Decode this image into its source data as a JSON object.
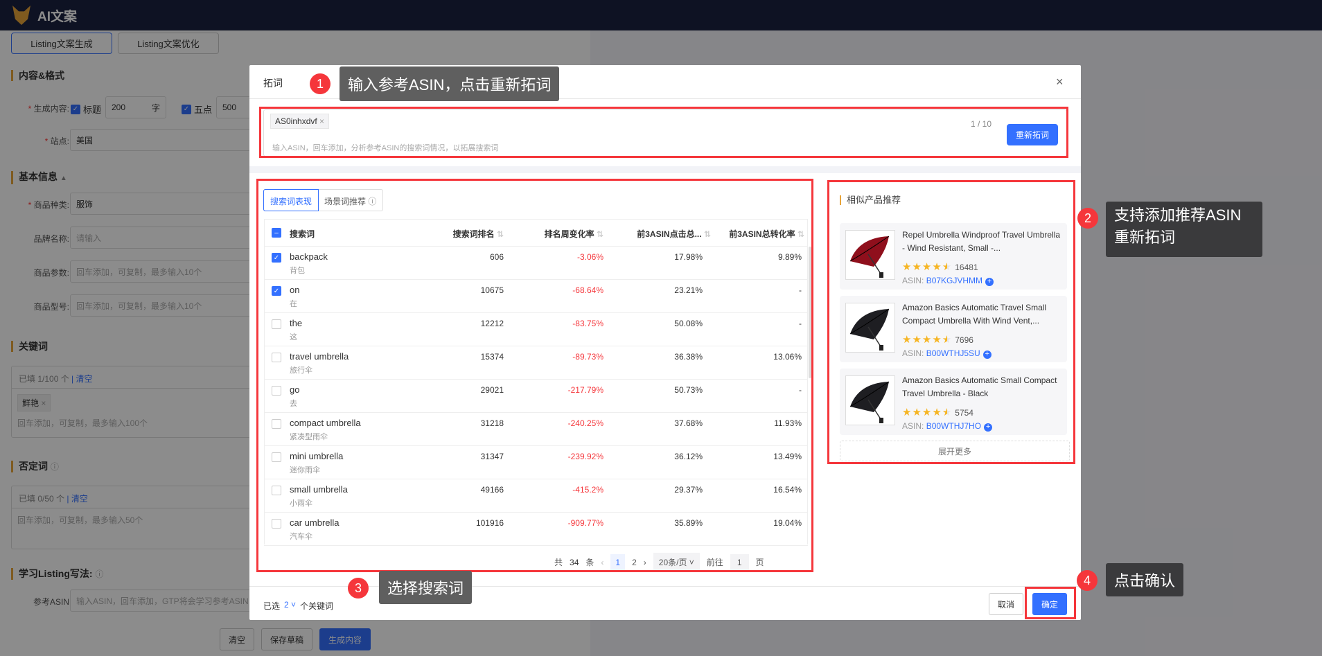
{
  "app": {
    "title": "AI文案"
  },
  "mode_tabs": [
    {
      "label": "Listing文案生成",
      "active": true
    },
    {
      "label": "Listing文案优化",
      "active": false
    }
  ],
  "form": {
    "content_section": "内容&格式",
    "generate_label": "生成内容:",
    "title_check": "标题",
    "title_len": "200",
    "title_unit": "字",
    "bullet_check": "五点",
    "bullet_len": "500",
    "site_label": "站点:",
    "site_value": "美国",
    "basic_section": "基本信息",
    "category_label": "商品种类:",
    "category_value": "服饰",
    "brand_label": "品牌名称:",
    "brand_placeholder": "请输入",
    "params_label": "商品参数:",
    "params_placeholder": "回车添加，可复制，最多输入10个",
    "model_label": "商品型号:",
    "model_placeholder": "回车添加，可复制，最多输入10个",
    "keyword_section": "关键词",
    "keyword_count": "已填 1/100 个",
    "keyword_clear": "清空",
    "keyword_tag": "鲜艳",
    "keyword_placeholder": "回车添加，可复制，最多输入100个",
    "negative_section": "否定词",
    "negative_count": "已填 0/50 个",
    "negative_clear": "清空",
    "negative_placeholder": "回车添加，可复制，最多输入50个",
    "learn_section": "学习Listing写法:",
    "ref_label": "参考ASIN",
    "ref_placeholder": "输入ASIN，回车添加，GTP将会学习参考ASIN",
    "btn_clear": "清空",
    "btn_draft": "保存草稿",
    "btn_generate": "生成内容"
  },
  "modal": {
    "title": "拓词",
    "asin_tag": "AS0inhxdvf",
    "asin_placeholder": "输入ASIN，回车添加，分析参考ASIN的搜索词情况，以拓展搜索词",
    "asin_count": "1 / 10",
    "reexpand": "重新拓词",
    "tabs": [
      "搜索词表现",
      "场景词推荐"
    ],
    "columns": [
      "搜索词",
      "搜索词排名",
      "排名周变化率",
      "前3ASIN点击总...",
      "前3ASIN总转化率"
    ],
    "rows": [
      {
        "kw": "backpack",
        "zh": "背包",
        "rank": "606",
        "change": "-3.06%",
        "click": "17.98%",
        "conv": "9.89%",
        "checked": true
      },
      {
        "kw": "on",
        "zh": "在",
        "rank": "10675",
        "change": "-68.64%",
        "click": "23.21%",
        "conv": "-",
        "checked": true
      },
      {
        "kw": "the",
        "zh": "这",
        "rank": "12212",
        "change": "-83.75%",
        "click": "50.08%",
        "conv": "-",
        "checked": false
      },
      {
        "kw": "travel umbrella",
        "zh": "旅行伞",
        "rank": "15374",
        "change": "-89.73%",
        "click": "36.38%",
        "conv": "13.06%",
        "checked": false
      },
      {
        "kw": "go",
        "zh": "去",
        "rank": "29021",
        "change": "-217.79%",
        "click": "50.73%",
        "conv": "-",
        "checked": false
      },
      {
        "kw": "compact umbrella",
        "zh": "紧凑型雨伞",
        "rank": "31218",
        "change": "-240.25%",
        "click": "37.68%",
        "conv": "11.93%",
        "checked": false
      },
      {
        "kw": "mini umbrella",
        "zh": "迷你雨伞",
        "rank": "31347",
        "change": "-239.92%",
        "click": "36.12%",
        "conv": "13.49%",
        "checked": false
      },
      {
        "kw": "small umbrella",
        "zh": "小雨伞",
        "rank": "49166",
        "change": "-415.2%",
        "click": "29.37%",
        "conv": "16.54%",
        "checked": false
      },
      {
        "kw": "car umbrella",
        "zh": "汽车伞",
        "rank": "101916",
        "change": "-909.77%",
        "click": "35.89%",
        "conv": "19.04%",
        "checked": false
      }
    ],
    "pagination": {
      "total_prefix": "共",
      "total": "34",
      "total_suffix": "条",
      "pages": [
        "1",
        "2"
      ],
      "current": "1",
      "page_size": "20条/页",
      "goto": "前往",
      "goto_value": "1",
      "goto_suffix": "页"
    },
    "similar_title": "相似产品推荐",
    "products": [
      {
        "name": "Repel Umbrella Windproof Travel Umbrella - Wind Resistant, Small -...",
        "rating": 4.5,
        "reviews": "16481",
        "asin_label": "ASIN:",
        "asin": "B07KGJVHMM",
        "color": "#8f0f1c"
      },
      {
        "name": "Amazon Basics Automatic Travel Small Compact Umbrella With Wind Vent,...",
        "rating": 4.5,
        "reviews": "7696",
        "asin_label": "ASIN:",
        "asin": "B00WTHJ5SU",
        "color": "#1e1e22"
      },
      {
        "name": "Amazon Basics Automatic Small Compact Travel Umbrella - Black",
        "rating": 4.5,
        "reviews": "5754",
        "asin_label": "ASIN:",
        "asin": "B00WTHJ7HO",
        "color": "#1e1e22"
      }
    ],
    "expand_more": "展开更多",
    "selected_prefix": "已选",
    "selected_count": "2",
    "selected_suffix": "个关键词",
    "cancel": "取消",
    "confirm": "确定"
  },
  "annotations": [
    {
      "num": "1",
      "text": "输入参考ASIN，点击重新拓词"
    },
    {
      "num": "2",
      "text": "支持添加推荐ASIN重新拓词"
    },
    {
      "num": "3",
      "text": "选择搜索词"
    },
    {
      "num": "4",
      "text": "点击确认"
    }
  ],
  "colors": {
    "accent": "#3370ff",
    "negative": "#f5363b",
    "highlight": "#f5363b"
  }
}
